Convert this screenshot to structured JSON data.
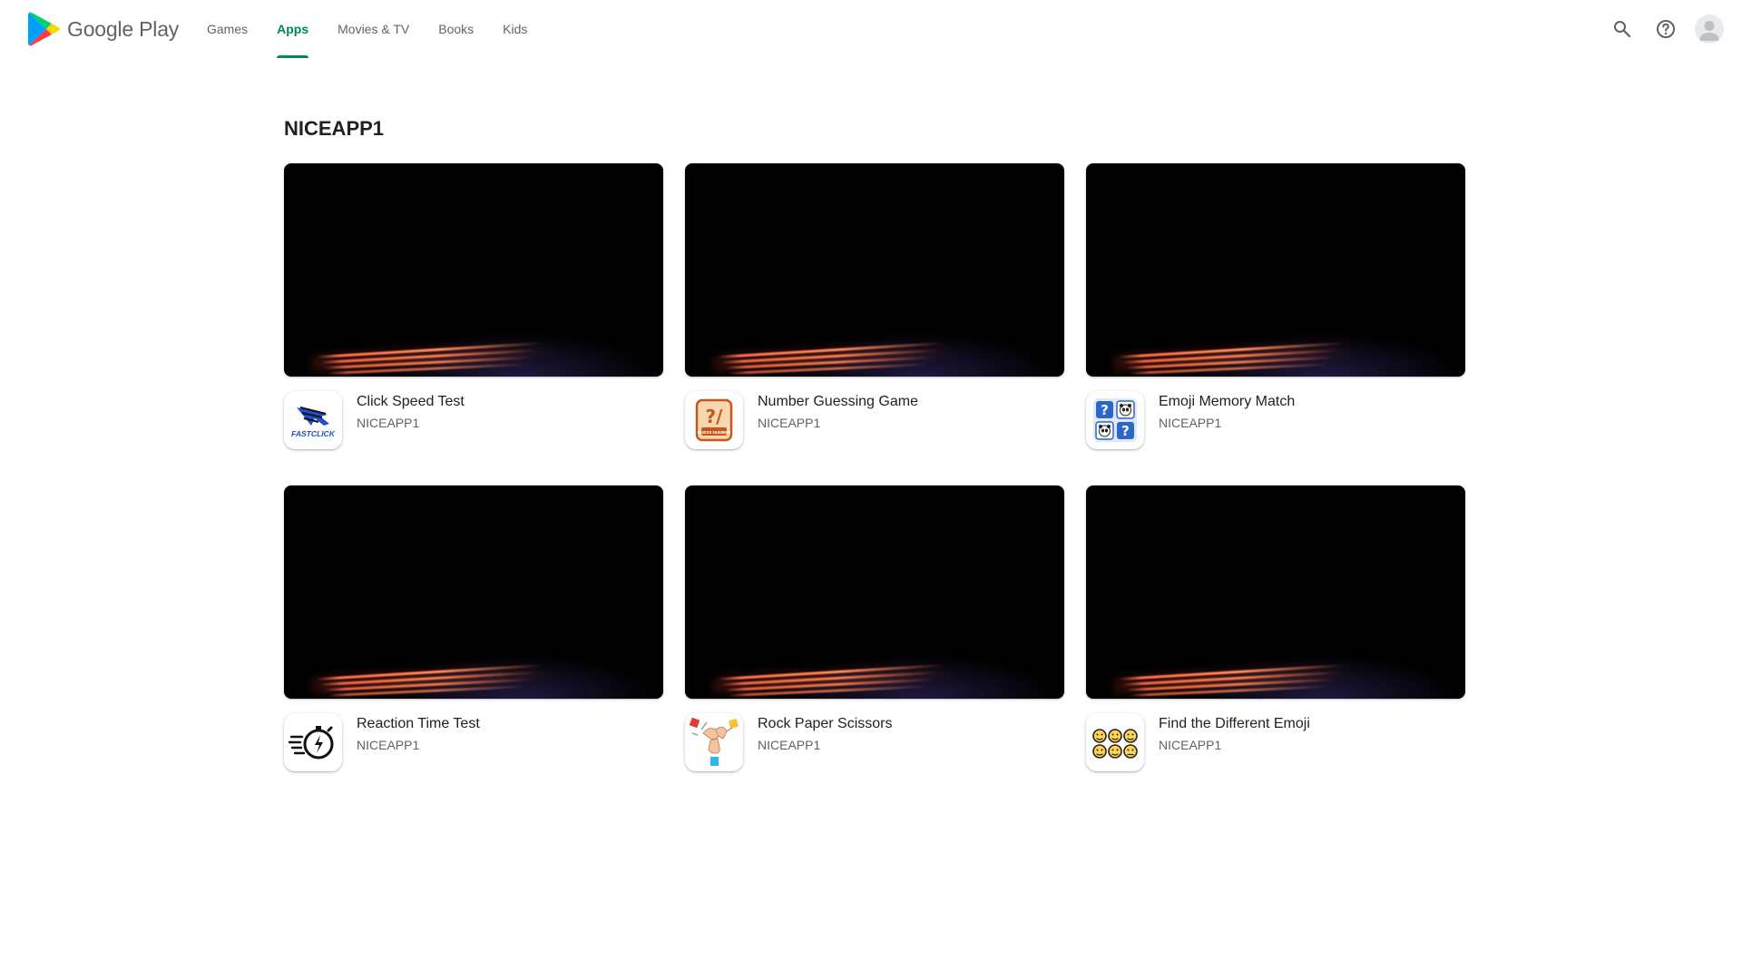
{
  "header": {
    "brand_name": "Google Play",
    "brand_icon": "google-play-logo",
    "nav": [
      {
        "label": "Games",
        "active": false
      },
      {
        "label": "Apps",
        "active": true
      },
      {
        "label": "Movies & TV",
        "active": false
      },
      {
        "label": "Books",
        "active": false
      },
      {
        "label": "Kids",
        "active": false
      }
    ],
    "actions": [
      "search-icon",
      "help-icon",
      "account-avatar"
    ]
  },
  "colors": {
    "accent": "#01875f",
    "text_primary": "#202124",
    "text_secondary": "#5f6368",
    "preview_bg": "#000000",
    "streak": "#ff6b4a"
  },
  "developer": {
    "title": "NICEAPP1"
  },
  "apps": [
    {
      "name": "Click Speed Test",
      "developer": "NICEAPP1",
      "icon": "fast-click-icon"
    },
    {
      "name": "Number Guessing Game",
      "developer": "NICEAPP1",
      "icon": "guess-number-icon"
    },
    {
      "name": "Emoji Memory Match",
      "developer": "NICEAPP1",
      "icon": "panda-memory-icon"
    },
    {
      "name": "Reaction Time Test",
      "developer": "NICEAPP1",
      "icon": "stopwatch-icon"
    },
    {
      "name": "Rock Paper Scissors",
      "developer": "NICEAPP1",
      "icon": "hand-gesture-icon"
    },
    {
      "name": "Find the Different Emoji",
      "developer": "NICEAPP1",
      "icon": "emoji-grid-icon"
    }
  ],
  "icon_text": {
    "fast_click": "FASTCLICK",
    "guess_top": "?/",
    "guess_label": "GUESS NUMBER"
  }
}
